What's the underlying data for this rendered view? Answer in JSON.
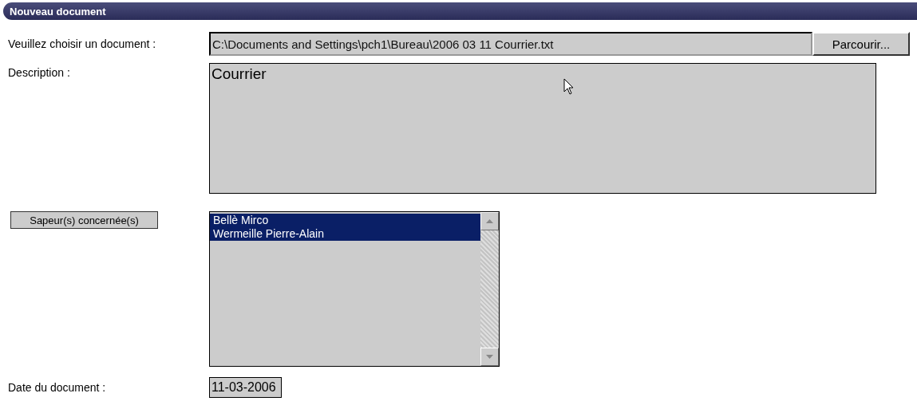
{
  "header": {
    "title": "Nouveau document"
  },
  "file_row": {
    "label": "Veuillez choisir un document :",
    "value": "C:\\Documents and Settings\\pch1\\Bureau\\2006 03 11 Courrier.txt",
    "button": "Parcourir..."
  },
  "description": {
    "label": "Description :",
    "value": "Courrier"
  },
  "sapeurs": {
    "button": "Sapeur(s) concernée(s)",
    "items": [
      {
        "name": "Bellè Mirco",
        "selected": true
      },
      {
        "name": "Wermeille Pierre-Alain",
        "selected": true
      }
    ]
  },
  "date": {
    "label": "Date du document :",
    "value": "11-03-2006"
  }
}
